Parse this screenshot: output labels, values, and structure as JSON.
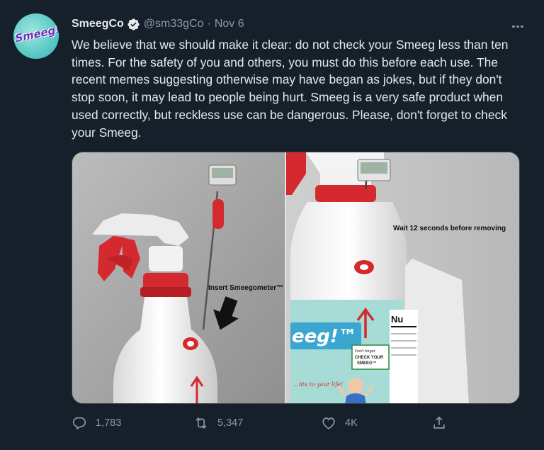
{
  "author": {
    "name": "SmeegCo",
    "handle": "@sm33gCo",
    "date": "Nov 6",
    "separator": "·",
    "avatar_text": "Smeeg!"
  },
  "tweet": {
    "text": "We believe that we should make it clear: do not check your Smeeg less than ten times. For the safety of you and others, you must do this before each use. The recent memes suggesting otherwise may have began as jokes, but if they don't stop soon, it may lead to people being hurt. Smeeg is a very safe product when used correctly, but reckless use can be dangerous. Please, don't forget to check your Smeeg."
  },
  "media": {
    "left_caption": "Insert Smeegometer™",
    "right_caption": "Wait 12 seconds before removing",
    "label_logo_left": "",
    "label_logo_right": "eeg!™",
    "label_tagline": "...nts to your life!",
    "sticker_text": "Don't forget CHECK YOUR SMEEG",
    "nutrition_text": "Nu"
  },
  "actions": {
    "replies": "1,783",
    "retweets": "5,347",
    "likes": "4K"
  },
  "icons": {
    "verified": "verified-badge-icon",
    "more": "more-options-icon",
    "reply": "reply-icon",
    "retweet": "retweet-icon",
    "like": "heart-icon",
    "share": "share-icon"
  },
  "colors": {
    "background": "#15202b",
    "text": "#e7e9ea",
    "muted": "#8b98a5",
    "bottle_red": "#d42a2f",
    "label_teal": "#a7dcd6"
  }
}
